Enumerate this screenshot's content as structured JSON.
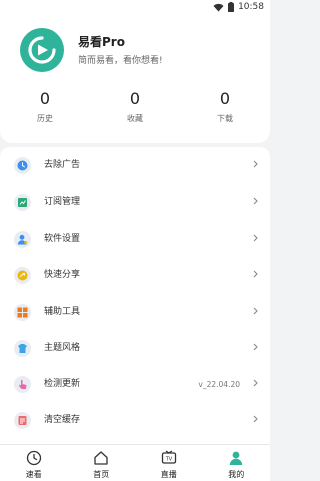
{
  "status_bar": {
    "time": "10:58"
  },
  "profile": {
    "app_name": "易看Pro",
    "slogan": "简而易看，看你想看!",
    "stats": [
      {
        "value": "0",
        "label": "历史"
      },
      {
        "value": "0",
        "label": "收藏"
      },
      {
        "value": "0",
        "label": "下载"
      }
    ]
  },
  "menu": {
    "items": [
      {
        "label": "去除广告",
        "icon": "clock-icon",
        "color": "#3b8ff0"
      },
      {
        "label": "订阅管理",
        "icon": "subscription-icon",
        "color": "#2aa876"
      },
      {
        "label": "软件设置",
        "icon": "user-settings-icon",
        "color": "#3b8ff0"
      },
      {
        "label": "快速分享",
        "icon": "share-icon",
        "color": "#f2b705"
      },
      {
        "label": "辅助工具",
        "icon": "tools-icon",
        "color": "#f07b1a"
      },
      {
        "label": "主题风格",
        "icon": "theme-icon",
        "color": "#3aa6e8"
      },
      {
        "label": "检测更新",
        "icon": "update-icon",
        "color": "#e86aa8",
        "value": "v_22.04.20"
      },
      {
        "label": "清空缓存",
        "icon": "clear-cache-icon",
        "color": "#ef6a6a"
      }
    ]
  },
  "tabbar": {
    "tabs": [
      {
        "label": "速看",
        "icon": "speed-watch-icon"
      },
      {
        "label": "首页",
        "icon": "home-icon"
      },
      {
        "label": "直播",
        "icon": "tv-icon"
      },
      {
        "label": "我的",
        "icon": "profile-icon",
        "active": true
      }
    ],
    "active_color": "#2fb39a"
  }
}
